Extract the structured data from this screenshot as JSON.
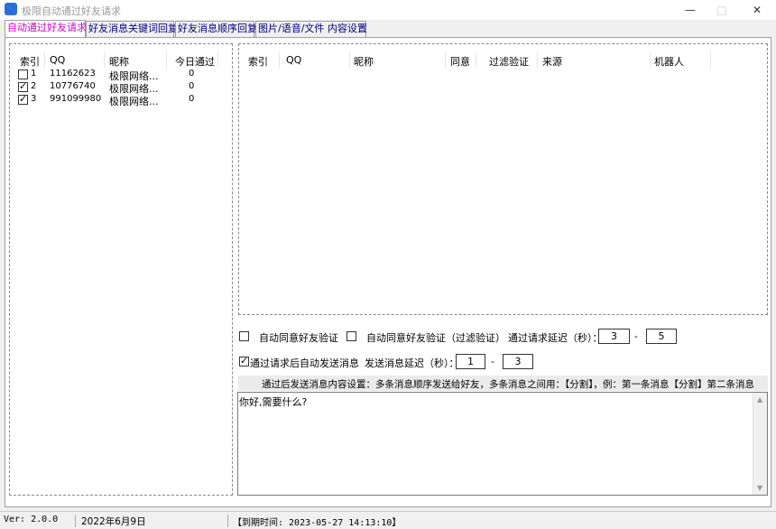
{
  "window": {
    "title": "极限自动通过好友请求"
  },
  "tabs": [
    {
      "label": "自动通过好友请求"
    },
    {
      "label": "好友消息关键词回复"
    },
    {
      "label": "好友消息顺序回复"
    },
    {
      "label": "图片/语音/文件 内容设置"
    }
  ],
  "left_table": {
    "headers": [
      "索引",
      "QQ",
      "昵称",
      "今日通过"
    ],
    "rows": [
      {
        "checked": false,
        "index": "1",
        "qq": "11162623",
        "nick": "极限网络...",
        "today": "0"
      },
      {
        "checked": true,
        "index": "2",
        "qq": "10776740",
        "nick": "极限网络...",
        "today": "0"
      },
      {
        "checked": true,
        "index": "3",
        "qq": "991099980",
        "nick": "极限网络...",
        "today": "0"
      }
    ]
  },
  "right_table": {
    "headers": [
      "索引",
      "QQ",
      "昵称",
      "同意",
      "过滤验证",
      "来源",
      "机器人"
    ]
  },
  "options": {
    "auto_agree_label": "自动同意好友验证",
    "auto_agree_filter_label": "自动同意好友验证（过滤验证）",
    "delay_label": "通过请求延迟（秒）：",
    "delay_min": "3",
    "delay_dash": "-",
    "delay_max": "5",
    "send_after_label": "通过请求后自动发送消息",
    "send_delay_label": "发送消息延迟（秒）：",
    "send_delay_min": "1",
    "send_delay_dash": "-",
    "send_delay_max": "3",
    "auto_agree_checked": false,
    "auto_agree_filter_checked": false,
    "send_after_checked": true
  },
  "message": {
    "hint": "通过后发送消息内容设置：多条消息顺序发送给好友，多条消息之间用：【分割】，例：第一条消息【分割】第二条消息",
    "content": "你好,需要什么?"
  },
  "status": {
    "version": "Ver: 2.0.0",
    "date": "2022年6月9日",
    "expiry": "【到期时间: 2023-05-27 14:13:10】"
  }
}
